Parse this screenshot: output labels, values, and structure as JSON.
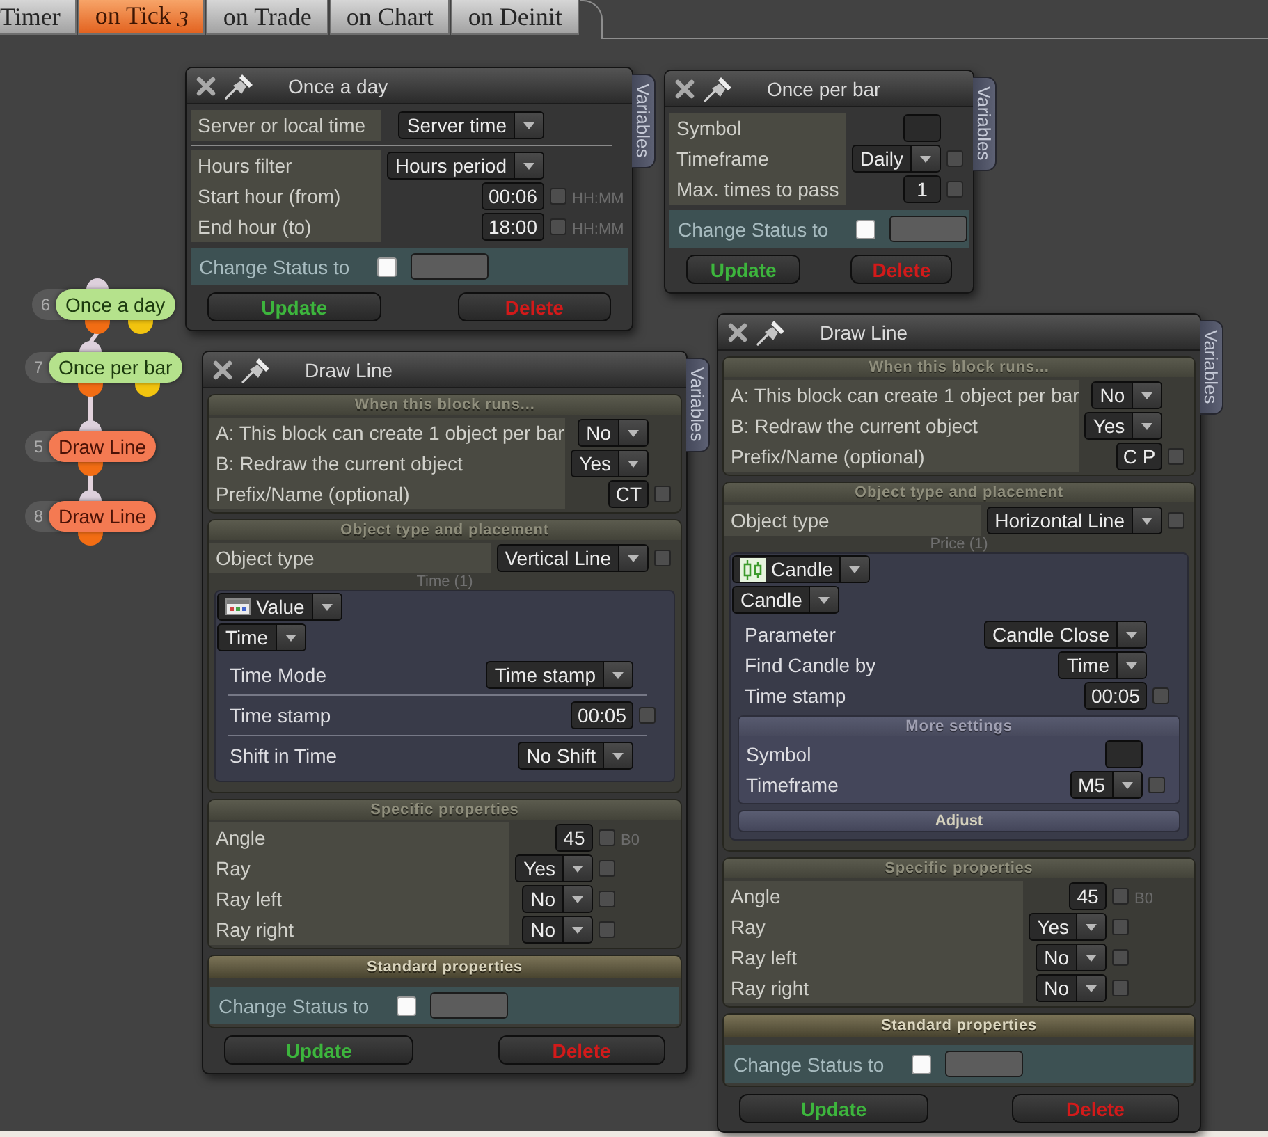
{
  "tabs": [
    {
      "label": "Timer",
      "selected": false
    },
    {
      "label": "on Tick",
      "count": "3",
      "selected": true
    },
    {
      "label": "on Trade",
      "selected": false
    },
    {
      "label": "on Chart",
      "selected": false
    },
    {
      "label": "on Deinit",
      "selected": false
    }
  ],
  "flow_nodes": [
    {
      "number": "6",
      "label": "Once a day",
      "kind": "condition",
      "color": "#b5e28c"
    },
    {
      "number": "7",
      "label": "Once per bar",
      "kind": "condition",
      "color": "#b5e28c"
    },
    {
      "number": "5",
      "label": "Draw Line",
      "kind": "action",
      "color": "#f47a52"
    },
    {
      "number": "8",
      "label": "Draw Line",
      "kind": "action",
      "color": "#f47a52"
    }
  ],
  "panels": [
    {
      "title": "Once a day",
      "side_tab": "Variables",
      "sections": [
        {
          "blocks": [
            {
              "kind": "fields",
              "rows": [
                {
                  "label": "Server or local time",
                  "control": {
                    "kind": "dropdown",
                    "value": "Server time"
                  }
                }
              ]
            },
            {
              "kind": "fields",
              "rows": [
                {
                  "label": "Hours filter",
                  "control": {
                    "kind": "dropdown",
                    "value": "Hours period"
                  }
                },
                {
                  "label": "Start hour (from)",
                  "control": {
                    "kind": "input",
                    "value": "00:06"
                  },
                  "checked": false,
                  "suffix": "HH:MM"
                },
                {
                  "label": "End hour (to)",
                  "control": {
                    "kind": "input",
                    "value": "18:00"
                  },
                  "checked": false,
                  "suffix": "HH:MM"
                }
              ]
            }
          ]
        },
        {
          "blocks": [
            {
              "kind": "status",
              "label": "Change Status to",
              "checked": false
            }
          ]
        }
      ],
      "buttons": [
        {
          "label": "Update",
          "kind": "update"
        },
        {
          "label": "Delete",
          "kind": "delete"
        }
      ]
    },
    {
      "title": "Once per bar",
      "side_tab": "Variables",
      "sections": [
        {
          "blocks": [
            {
              "kind": "fields",
              "rows": [
                {
                  "label": "Symbol",
                  "control": {
                    "kind": "input"
                  }
                },
                {
                  "label": "Timeframe",
                  "control": {
                    "kind": "dropdown",
                    "value": "Daily"
                  },
                  "checked": false
                },
                {
                  "label": "Max. times to pass",
                  "control": {
                    "kind": "input",
                    "value": "1"
                  },
                  "checked": false
                }
              ]
            }
          ]
        },
        {
          "blocks": [
            {
              "kind": "status",
              "label": "Change Status to",
              "checked": false
            }
          ]
        }
      ],
      "buttons": [
        {
          "label": "Update",
          "kind": "update"
        },
        {
          "label": "Delete",
          "kind": "delete"
        }
      ]
    },
    {
      "title": "Draw Line",
      "side_tab": "Variables",
      "sections": [
        {
          "header": "When this block runs...",
          "emphasized": false,
          "blocks": [
            {
              "kind": "fields",
              "rows": [
                {
                  "label": "A: This block can create 1 object per bar",
                  "control": {
                    "kind": "dropdown",
                    "value": "No"
                  }
                },
                {
                  "label": "B: Redraw the current object",
                  "control": {
                    "kind": "dropdown",
                    "value": "Yes"
                  }
                },
                {
                  "label": "Prefix/Name (optional)",
                  "control": {
                    "kind": "input",
                    "value": "CT"
                  },
                  "checked": false
                }
              ]
            }
          ]
        },
        {
          "header": "Object type and placement",
          "emphasized": false,
          "blocks": [
            {
              "kind": "fields",
              "rows": [
                {
                  "label": "Object type",
                  "control": {
                    "kind": "dropdown",
                    "value": "Vertical Line"
                  },
                  "checked": false
                }
              ]
            },
            {
              "kind": "source",
              "caption": "Time (1)",
              "divided": true,
              "selectors": [
                {
                  "kind": "value",
                  "value": "Value"
                },
                {
                  "kind": "plain",
                  "value": "Time"
                }
              ],
              "rows": [
                {
                  "label": "Time Mode",
                  "control": {
                    "kind": "dropdown",
                    "value": "Time stamp"
                  }
                },
                {
                  "label": "Time stamp",
                  "control": {
                    "kind": "input",
                    "value": "00:05"
                  },
                  "checked": false
                },
                {
                  "label": "Shift in Time",
                  "control": {
                    "kind": "dropdown",
                    "value": "No Shift"
                  }
                }
              ]
            }
          ]
        },
        {
          "header": "Specific properties",
          "emphasized": false,
          "blocks": [
            {
              "kind": "fields",
              "rows": [
                {
                  "label": "Angle",
                  "control": {
                    "kind": "input",
                    "value": "45"
                  },
                  "checked": false,
                  "suffix": "B0"
                },
                {
                  "label": "Ray",
                  "control": {
                    "kind": "dropdown",
                    "value": "Yes"
                  },
                  "checked": false
                },
                {
                  "label": "Ray left",
                  "control": {
                    "kind": "dropdown",
                    "value": "No"
                  },
                  "checked": false
                },
                {
                  "label": "Ray right",
                  "control": {
                    "kind": "dropdown",
                    "value": "No"
                  },
                  "checked": false
                }
              ]
            }
          ]
        },
        {
          "header": "Standard properties",
          "emphasized": true,
          "blocks": [
            {
              "kind": "status",
              "label": "Change Status to",
              "checked": false
            }
          ]
        }
      ],
      "buttons": [
        {
          "label": "Update",
          "kind": "update"
        },
        {
          "label": "Delete",
          "kind": "delete"
        }
      ]
    },
    {
      "title": "Draw Line",
      "side_tab": "Variables",
      "sections": [
        {
          "header": "When this block runs...",
          "emphasized": false,
          "blocks": [
            {
              "kind": "fields",
              "rows": [
                {
                  "label": "A: This block can create 1 object per bar",
                  "control": {
                    "kind": "dropdown",
                    "value": "No"
                  }
                },
                {
                  "label": "B: Redraw the current object",
                  "control": {
                    "kind": "dropdown",
                    "value": "Yes"
                  }
                },
                {
                  "label": "Prefix/Name (optional)",
                  "control": {
                    "kind": "input",
                    "value": "C P"
                  },
                  "checked": false
                }
              ]
            }
          ]
        },
        {
          "header": "Object type and placement",
          "emphasized": false,
          "blocks": [
            {
              "kind": "fields",
              "rows": [
                {
                  "label": "Object type",
                  "control": {
                    "kind": "dropdown",
                    "value": "Horizontal Line"
                  },
                  "checked": false
                }
              ]
            },
            {
              "kind": "source",
              "caption": "Price (1)",
              "divided": false,
              "selectors": [
                {
                  "kind": "candle",
                  "value": "Candle"
                },
                {
                  "kind": "plain",
                  "value": "Candle"
                }
              ],
              "rows": [
                {
                  "label": "Parameter",
                  "control": {
                    "kind": "dropdown",
                    "value": "Candle Close"
                  }
                },
                {
                  "label": "Find Candle by",
                  "control": {
                    "kind": "dropdown",
                    "value": "Time"
                  }
                },
                {
                  "label": "Time stamp",
                  "control": {
                    "kind": "input",
                    "value": "00:05"
                  },
                  "checked": false
                }
              ],
              "more": {
                "header": "More settings",
                "rows": [
                  {
                    "label": "Symbol",
                    "control": {
                      "kind": "input"
                    }
                  },
                  {
                    "label": "Timeframe",
                    "control": {
                      "kind": "dropdown",
                      "value": "M5"
                    },
                    "checked": false
                  }
                ]
              },
              "action": "Adjust"
            }
          ]
        },
        {
          "header": "Specific properties",
          "emphasized": false,
          "blocks": [
            {
              "kind": "fields",
              "rows": [
                {
                  "label": "Angle",
                  "control": {
                    "kind": "input",
                    "value": "45"
                  },
                  "checked": false,
                  "suffix": "B0"
                },
                {
                  "label": "Ray",
                  "control": {
                    "kind": "dropdown",
                    "value": "Yes"
                  },
                  "checked": false
                },
                {
                  "label": "Ray left",
                  "control": {
                    "kind": "dropdown",
                    "value": "No"
                  },
                  "checked": false
                },
                {
                  "label": "Ray right",
                  "control": {
                    "kind": "dropdown",
                    "value": "No"
                  },
                  "checked": false
                }
              ]
            }
          ]
        },
        {
          "header": "Standard properties",
          "emphasized": true,
          "blocks": [
            {
              "kind": "status",
              "label": "Change Status to",
              "checked": false
            }
          ]
        }
      ],
      "buttons": [
        {
          "label": "Update",
          "kind": "update"
        },
        {
          "label": "Delete",
          "kind": "delete"
        }
      ]
    }
  ]
}
